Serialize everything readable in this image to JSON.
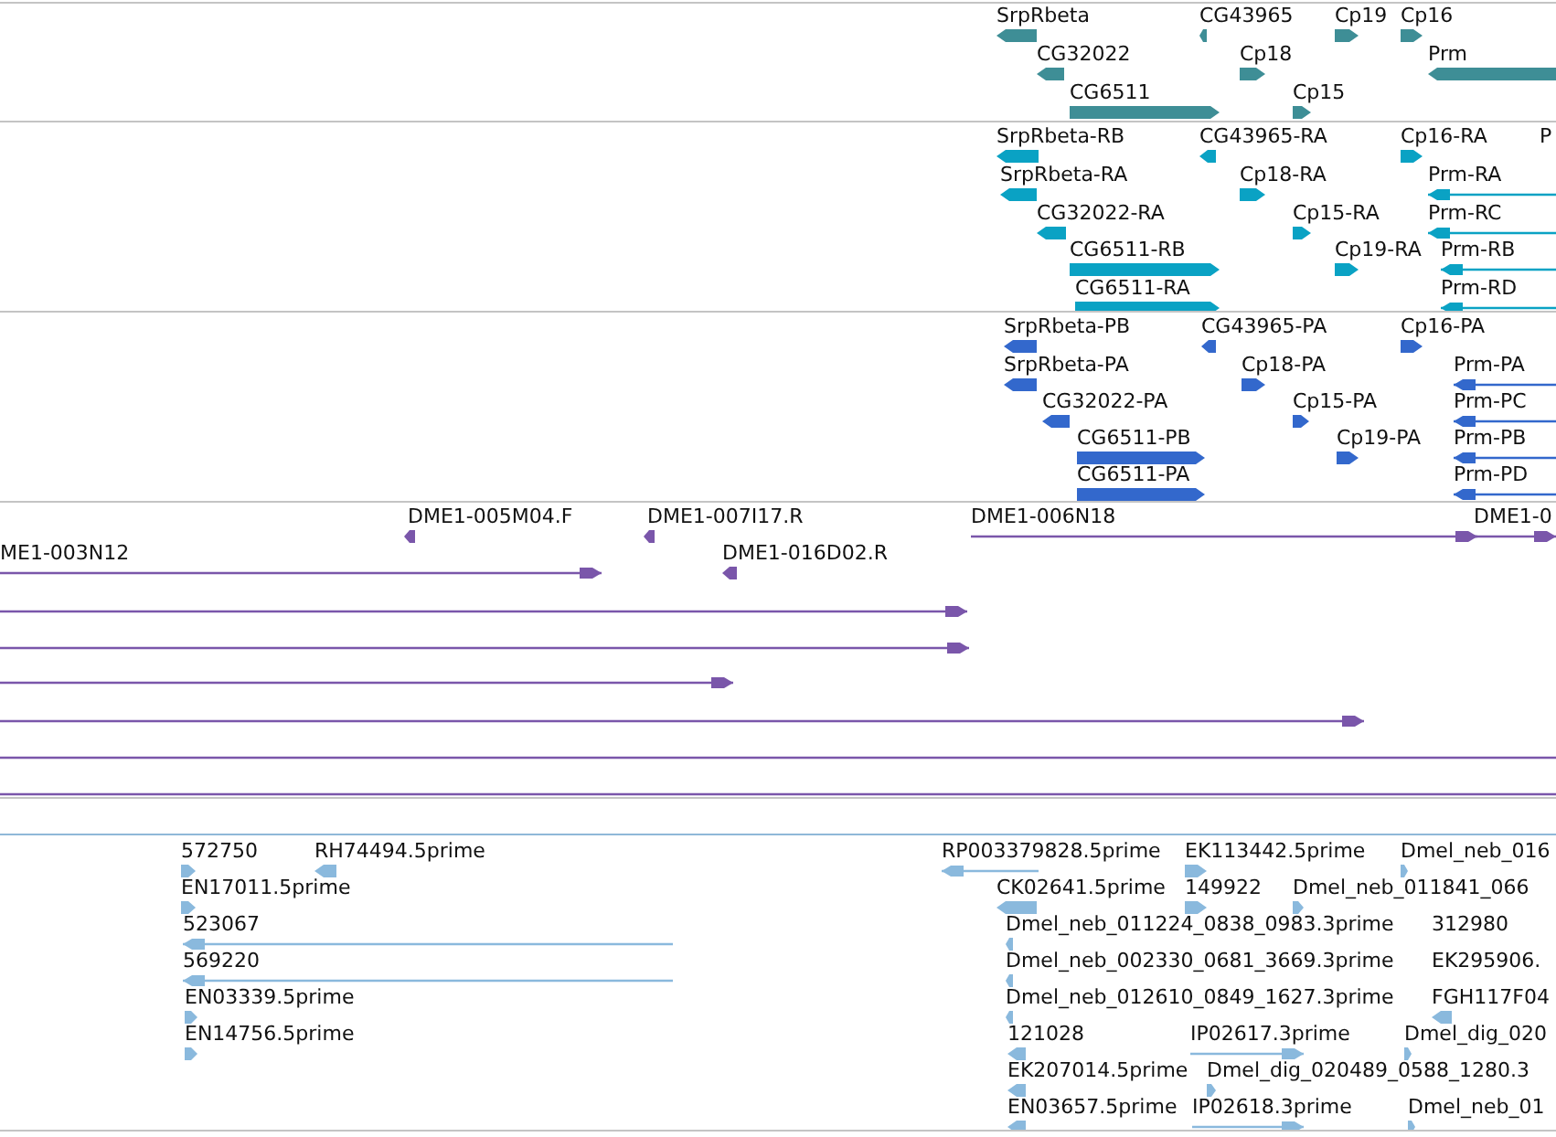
{
  "tracks": [
    {
      "kind": "gene",
      "features": [
        {
          "label": "SrpRbeta",
          "reverse": true
        },
        {
          "label": "CG43965",
          "reverse": true
        },
        {
          "label": "Cp19",
          "reverse": false
        },
        {
          "label": "Cp16",
          "reverse": false
        },
        {
          "label": "CG32022",
          "reverse": true
        },
        {
          "label": "Cp18",
          "reverse": false
        },
        {
          "label": "Prm",
          "reverse": true
        },
        {
          "label": "CG6511",
          "reverse": false
        },
        {
          "label": "Cp15",
          "reverse": false
        }
      ]
    },
    {
      "kind": "transcript",
      "features": [
        {
          "label": "SrpRbeta-RB",
          "reverse": true
        },
        {
          "label": "CG43965-RA",
          "reverse": true
        },
        {
          "label": "Cp16-RA",
          "reverse": false
        },
        {
          "label": "P"
        },
        {
          "label": "SrpRbeta-RA",
          "reverse": true
        },
        {
          "label": "Cp18-RA",
          "reverse": false
        },
        {
          "label": "Prm-RA",
          "reverse": true
        },
        {
          "label": "CG32022-RA",
          "reverse": true
        },
        {
          "label": "Cp15-RA",
          "reverse": false
        },
        {
          "label": "Prm-RC",
          "reverse": true
        },
        {
          "label": "CG6511-RB",
          "reverse": false
        },
        {
          "label": "Cp19-RA",
          "reverse": false
        },
        {
          "label": "Prm-RB",
          "reverse": true
        },
        {
          "label": "CG6511-RA",
          "reverse": false
        },
        {
          "label": "Prm-RD",
          "reverse": true
        }
      ]
    },
    {
      "kind": "protein",
      "features": [
        {
          "label": "SrpRbeta-PB",
          "reverse": true
        },
        {
          "label": "CG43965-PA",
          "reverse": true
        },
        {
          "label": "Cp16-PA",
          "reverse": false
        },
        {
          "label": "SrpRbeta-PA",
          "reverse": true
        },
        {
          "label": "Cp18-PA",
          "reverse": false
        },
        {
          "label": "Prm-PA",
          "reverse": true
        },
        {
          "label": "CG32022-PA",
          "reverse": true
        },
        {
          "label": "Cp15-PA",
          "reverse": false
        },
        {
          "label": "Prm-PC",
          "reverse": true
        },
        {
          "label": "CG6511-PB",
          "reverse": false
        },
        {
          "label": "Cp19-PA",
          "reverse": false
        },
        {
          "label": "Prm-PB",
          "reverse": true
        },
        {
          "label": "CG6511-PA",
          "reverse": false
        },
        {
          "label": "Prm-PD",
          "reverse": true
        }
      ]
    },
    {
      "kind": "clone",
      "features": [
        {
          "label": "DME1-005M04.F",
          "reverse": true
        },
        {
          "label": "DME1-007I17.R",
          "reverse": true
        },
        {
          "label": "DME1-006N18",
          "reverse": false
        },
        {
          "label": "DME1-0",
          "reverse": false
        },
        {
          "label": "ME1-003N12",
          "reverse": false
        },
        {
          "label": "DME1-016D02.R",
          "reverse": true
        },
        {
          "reverse": false
        },
        {
          "reverse": false
        },
        {
          "reverse": false
        },
        {
          "reverse": false
        },
        {
          "reverse": false
        },
        {
          "reverse": false
        }
      ]
    },
    {
      "kind": "est",
      "features": [
        {
          "label": "572750",
          "reverse": false
        },
        {
          "label": "RH74494.5prime",
          "reverse": true
        },
        {
          "label": "EN17011.5prime",
          "reverse": false
        },
        {
          "label": "523067",
          "reverse": true
        },
        {
          "label": "569220",
          "reverse": true
        },
        {
          "label": "EN03339.5prime",
          "reverse": false
        },
        {
          "label": "EN14756.5prime",
          "reverse": false
        },
        {
          "label": "RP003379828.5prime",
          "reverse": true
        },
        {
          "label": "EK113442.5prime",
          "reverse": false
        },
        {
          "label": "Dmel_neb_016",
          "reverse": false
        },
        {
          "label": "CK02641.5prime",
          "reverse": true
        },
        {
          "label": "149922",
          "reverse": false
        },
        {
          "label": "Dmel_neb_011841_066",
          "reverse": false
        },
        {
          "label": "Dmel_neb_011224_0838_0983.3prime",
          "reverse": true
        },
        {
          "label": "312980"
        },
        {
          "label": "Dmel_neb_002330_0681_3669.3prime",
          "reverse": true
        },
        {
          "label": "EK295906."
        },
        {
          "label": "Dmel_neb_012610_0849_1627.3prime",
          "reverse": true
        },
        {
          "label": "FGH117F04",
          "reverse": true
        },
        {
          "label": "121028",
          "reverse": true
        },
        {
          "label": "IP02617.3prime",
          "reverse": false
        },
        {
          "label": "Dmel_dig_020",
          "reverse": false
        },
        {
          "label": "EK207014.5prime",
          "reverse": true
        },
        {
          "label": "Dmel_dig_020489_0588_1280.3",
          "reverse": false
        },
        {
          "label": "EN03657.5prime",
          "reverse": true
        },
        {
          "label": "IP02618.3prime",
          "reverse": false
        },
        {
          "label": "Dmel_neb_01",
          "reverse": false
        }
      ]
    }
  ]
}
